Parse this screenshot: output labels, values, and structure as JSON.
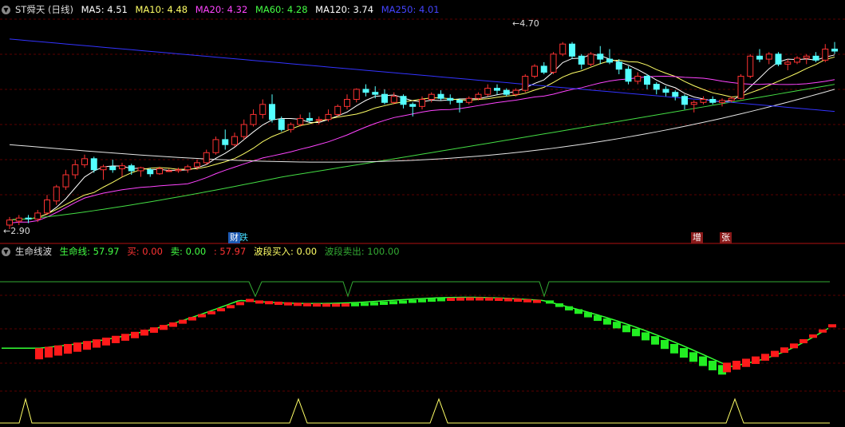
{
  "header": {
    "title": "ST舜天 (日线)",
    "ma": [
      {
        "label": "MA5: 4.51",
        "color": "#ffffff"
      },
      {
        "label": "MA10: 4.48",
        "color": "#ffff66"
      },
      {
        "label": "MA20: 4.32",
        "color": "#ff44ff"
      },
      {
        "label": "MA60: 4.28",
        "color": "#44ff44"
      },
      {
        "label": "MA120: 3.74",
        "color": "#ffffff"
      },
      {
        "label": "MA250: 4.01",
        "color": "#4444ff"
      }
    ]
  },
  "indicator": {
    "name": "生命线波",
    "items": [
      {
        "label": "生命线: 57.97",
        "color": "#44ff44"
      },
      {
        "label": "买: 0.00",
        "color": "#ff3333"
      },
      {
        "label": "卖: 0.00",
        "color": "#44ff44"
      },
      {
        "label": ": 57.97",
        "color": "#ff3333"
      },
      {
        "label": "波段买入: 0.00",
        "color": "#ffff66"
      },
      {
        "label": "波段卖出: 100.00",
        "color": "#33aa33"
      }
    ]
  },
  "annotations": {
    "high": "4.70",
    "low": "2.90",
    "tags": [
      {
        "text": "财",
        "bg": "#1e5ab4",
        "fg": "#ffffff"
      },
      {
        "text": "跌",
        "bg": "#000000",
        "fg": "#44ddff"
      },
      {
        "text": "增",
        "bg": "#8a1a1a",
        "fg": "#ffffff"
      },
      {
        "text": "张",
        "bg": "#8a1a1a",
        "fg": "#ffffff"
      }
    ]
  },
  "colors": {
    "up": "#ff3232",
    "down": "#54ffff",
    "grid": "#5a0000",
    "ma5": "#ffffff",
    "ma10": "#ffff66",
    "ma20": "#ff44ff",
    "ma60": "#44dd44",
    "ma120": "#e6e6e6",
    "ma250": "#3333ff",
    "life": "#33ff33",
    "buy": "#ff1a1a",
    "sell": "#22ee22",
    "band": "#ffff66",
    "bandsell": "#33aa33"
  },
  "chart_data": {
    "type": "candlestick",
    "price_range": [
      2.9,
      4.9
    ],
    "candles": [
      [
        2.9,
        2.98,
        2.86,
        2.95
      ],
      [
        2.94,
        3.0,
        2.9,
        2.97
      ],
      [
        2.97,
        3.0,
        2.92,
        2.96
      ],
      [
        2.96,
        3.05,
        2.93,
        3.02
      ],
      [
        3.02,
        3.2,
        3.0,
        3.15
      ],
      [
        3.14,
        3.3,
        3.1,
        3.28
      ],
      [
        3.28,
        3.45,
        3.25,
        3.4
      ],
      [
        3.4,
        3.55,
        3.36,
        3.5
      ],
      [
        3.5,
        3.6,
        3.47,
        3.56
      ],
      [
        3.56,
        3.58,
        3.42,
        3.45
      ],
      [
        3.45,
        3.5,
        3.35,
        3.48
      ],
      [
        3.48,
        3.55,
        3.42,
        3.45
      ],
      [
        3.46,
        3.52,
        3.38,
        3.49
      ],
      [
        3.49,
        3.51,
        3.4,
        3.44
      ],
      [
        3.44,
        3.48,
        3.38,
        3.47
      ],
      [
        3.45,
        3.47,
        3.38,
        3.41
      ],
      [
        3.41,
        3.48,
        3.4,
        3.46
      ],
      [
        3.44,
        3.46,
        3.43,
        3.44
      ],
      [
        3.44,
        3.47,
        3.42,
        3.45
      ],
      [
        3.45,
        3.5,
        3.42,
        3.48
      ],
      [
        3.48,
        3.55,
        3.45,
        3.52
      ],
      [
        3.52,
        3.65,
        3.5,
        3.62
      ],
      [
        3.62,
        3.78,
        3.6,
        3.75
      ],
      [
        3.75,
        3.85,
        3.65,
        3.7
      ],
      [
        3.7,
        3.82,
        3.68,
        3.78
      ],
      [
        3.78,
        3.95,
        3.75,
        3.9
      ],
      [
        3.9,
        4.05,
        3.88,
        4.0
      ],
      [
        4.0,
        4.15,
        3.96,
        4.1
      ],
      [
        4.1,
        4.2,
        3.92,
        3.95
      ],
      [
        3.95,
        3.98,
        3.83,
        3.85
      ],
      [
        3.85,
        3.92,
        3.82,
        3.9
      ],
      [
        3.9,
        4.0,
        3.88,
        3.96
      ],
      [
        3.96,
        4.02,
        3.92,
        3.94
      ],
      [
        3.94,
        3.98,
        3.9,
        3.95
      ],
      [
        3.95,
        4.05,
        3.93,
        4.0
      ],
      [
        4.0,
        4.1,
        3.98,
        4.08
      ],
      [
        4.08,
        4.2,
        4.05,
        4.15
      ],
      [
        4.15,
        4.26,
        4.12,
        4.25
      ],
      [
        4.25,
        4.3,
        4.18,
        4.22
      ],
      [
        4.22,
        4.28,
        4.16,
        4.2
      ],
      [
        4.2,
        4.25,
        4.1,
        4.12
      ],
      [
        4.12,
        4.22,
        4.1,
        4.18
      ],
      [
        4.18,
        4.2,
        4.06,
        4.1
      ],
      [
        4.1,
        4.12,
        3.98,
        4.08
      ],
      [
        4.08,
        4.18,
        4.05,
        4.15
      ],
      [
        4.15,
        4.22,
        4.12,
        4.2
      ],
      [
        4.2,
        4.24,
        4.14,
        4.16
      ],
      [
        4.16,
        4.2,
        4.1,
        4.14
      ],
      [
        4.14,
        4.16,
        4.02,
        4.12
      ],
      [
        4.12,
        4.18,
        4.1,
        4.16
      ],
      [
        4.16,
        4.22,
        4.14,
        4.2
      ],
      [
        4.2,
        4.3,
        4.18,
        4.26
      ],
      [
        4.26,
        4.3,
        4.2,
        4.24
      ],
      [
        4.24,
        4.26,
        4.18,
        4.2
      ],
      [
        4.2,
        4.26,
        4.18,
        4.24
      ],
      [
        4.24,
        4.4,
        4.22,
        4.38
      ],
      [
        4.38,
        4.5,
        4.36,
        4.48
      ],
      [
        4.48,
        4.52,
        4.4,
        4.42
      ],
      [
        4.42,
        4.62,
        4.4,
        4.6
      ],
      [
        4.6,
        4.72,
        4.58,
        4.7
      ],
      [
        4.7,
        4.72,
        4.55,
        4.58
      ],
      [
        4.58,
        4.6,
        4.45,
        4.5
      ],
      [
        4.5,
        4.62,
        4.48,
        4.6
      ],
      [
        4.6,
        4.68,
        4.5,
        4.55
      ],
      [
        4.55,
        4.65,
        4.5,
        4.52
      ],
      [
        4.52,
        4.55,
        4.4,
        4.45
      ],
      [
        4.45,
        4.48,
        4.3,
        4.33
      ],
      [
        4.33,
        4.42,
        4.3,
        4.38
      ],
      [
        4.38,
        4.4,
        4.25,
        4.3
      ],
      [
        4.3,
        4.32,
        4.2,
        4.25
      ],
      [
        4.25,
        4.28,
        4.18,
        4.22
      ],
      [
        4.22,
        4.24,
        4.14,
        4.18
      ],
      [
        4.18,
        4.2,
        4.05,
        4.1
      ],
      [
        4.1,
        4.14,
        4.02,
        4.12
      ],
      [
        4.12,
        4.18,
        4.1,
        4.15
      ],
      [
        4.15,
        4.18,
        4.1,
        4.12
      ],
      [
        4.12,
        4.16,
        4.08,
        4.14
      ],
      [
        4.14,
        4.18,
        4.12,
        4.16
      ],
      [
        4.16,
        4.4,
        4.15,
        4.38
      ],
      [
        4.38,
        4.6,
        4.36,
        4.58
      ],
      [
        4.58,
        4.65,
        4.52,
        4.55
      ],
      [
        4.55,
        4.62,
        4.5,
        4.6
      ],
      [
        4.6,
        4.62,
        4.48,
        4.5
      ],
      [
        4.5,
        4.55,
        4.44,
        4.52
      ],
      [
        4.52,
        4.58,
        4.5,
        4.56
      ],
      [
        4.56,
        4.6,
        4.5,
        4.58
      ],
      [
        4.58,
        4.62,
        4.52,
        4.54
      ],
      [
        4.54,
        4.7,
        4.52,
        4.65
      ],
      [
        4.65,
        4.72,
        4.6,
        4.63
      ]
    ]
  }
}
